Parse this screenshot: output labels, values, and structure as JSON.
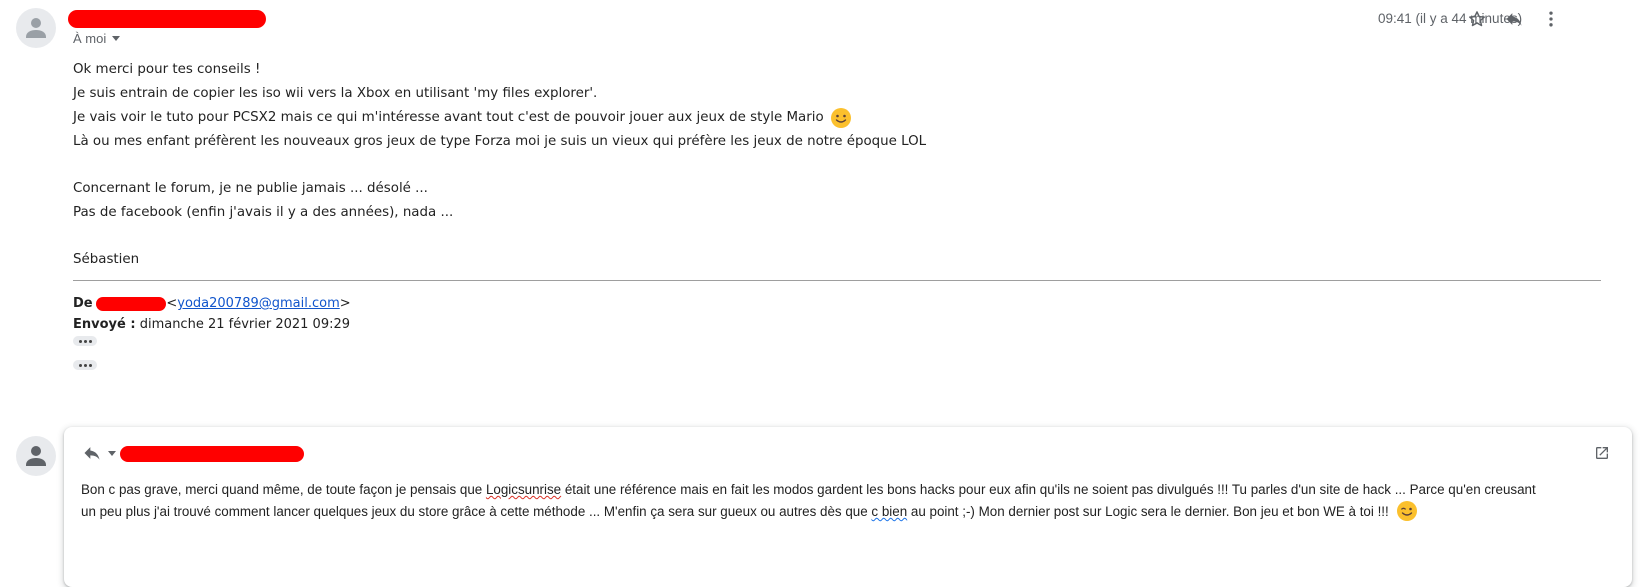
{
  "message": {
    "time": "09:41 (il y a 44 minutes)",
    "to_label": "À moi",
    "lines": [
      "Ok merci pour tes conseils !",
      "Je suis entrain de copier les iso wii vers la Xbox en utilisant 'my files explorer'.",
      "Je vais voir le tuto pour PCSX2 mais ce qui m'intéresse avant tout c'est de pouvoir jouer aux jeux de style Mario",
      "Là ou mes enfant préfèrent les nouveaux gros jeux de type Forza moi je suis un vieux qui préfère les jeux de notre époque LOL",
      "Concernant le forum, je ne publie jamais ... désolé ...",
      "Pas de facebook (enfin j'avais il y a des années), nada ...",
      "Sébastien"
    ],
    "quoted": {
      "from_label": "De :",
      "from_email": "yoda200789@gmail.com",
      "from_open": "<",
      "from_close": ">",
      "sent_label": "Envoyé :",
      "sent_value": "dimanche 21 février 2021 09:29"
    },
    "icons": {
      "star": "star-icon",
      "reply": "reply-icon",
      "more": "more-vert-icon"
    }
  },
  "reply": {
    "text_part1": "Bon c pas grave, merci quand même, de toute façon je pensais que ",
    "spell_word": "Logicsunrise",
    "text_part2": " était une référence mais en fait les modos gardent les bons hacks pour eux afin qu'ils ne soient pas divulgués !!! Tu parles d'un site de hack ... Parce qu'en creusant un peu plus j'ai trouvé comment lancer quelques jeux du store grâce à cette méthode ... M'enfin ça sera sur gueux ou autres dès que ",
    "spell_phrase": "c bien",
    "text_part3": " au point ;-) Mon dernier post sur Logic sera le dernier. Bon jeu et bon WE à toi !!!",
    "icons": {
      "reply_type": "reply-icon",
      "popout": "popout-icon"
    }
  },
  "colors": {
    "redaction": "#ff0000",
    "link": "#1155cc",
    "secondary_text": "#5f6368",
    "emoji": "#fbc02d"
  }
}
